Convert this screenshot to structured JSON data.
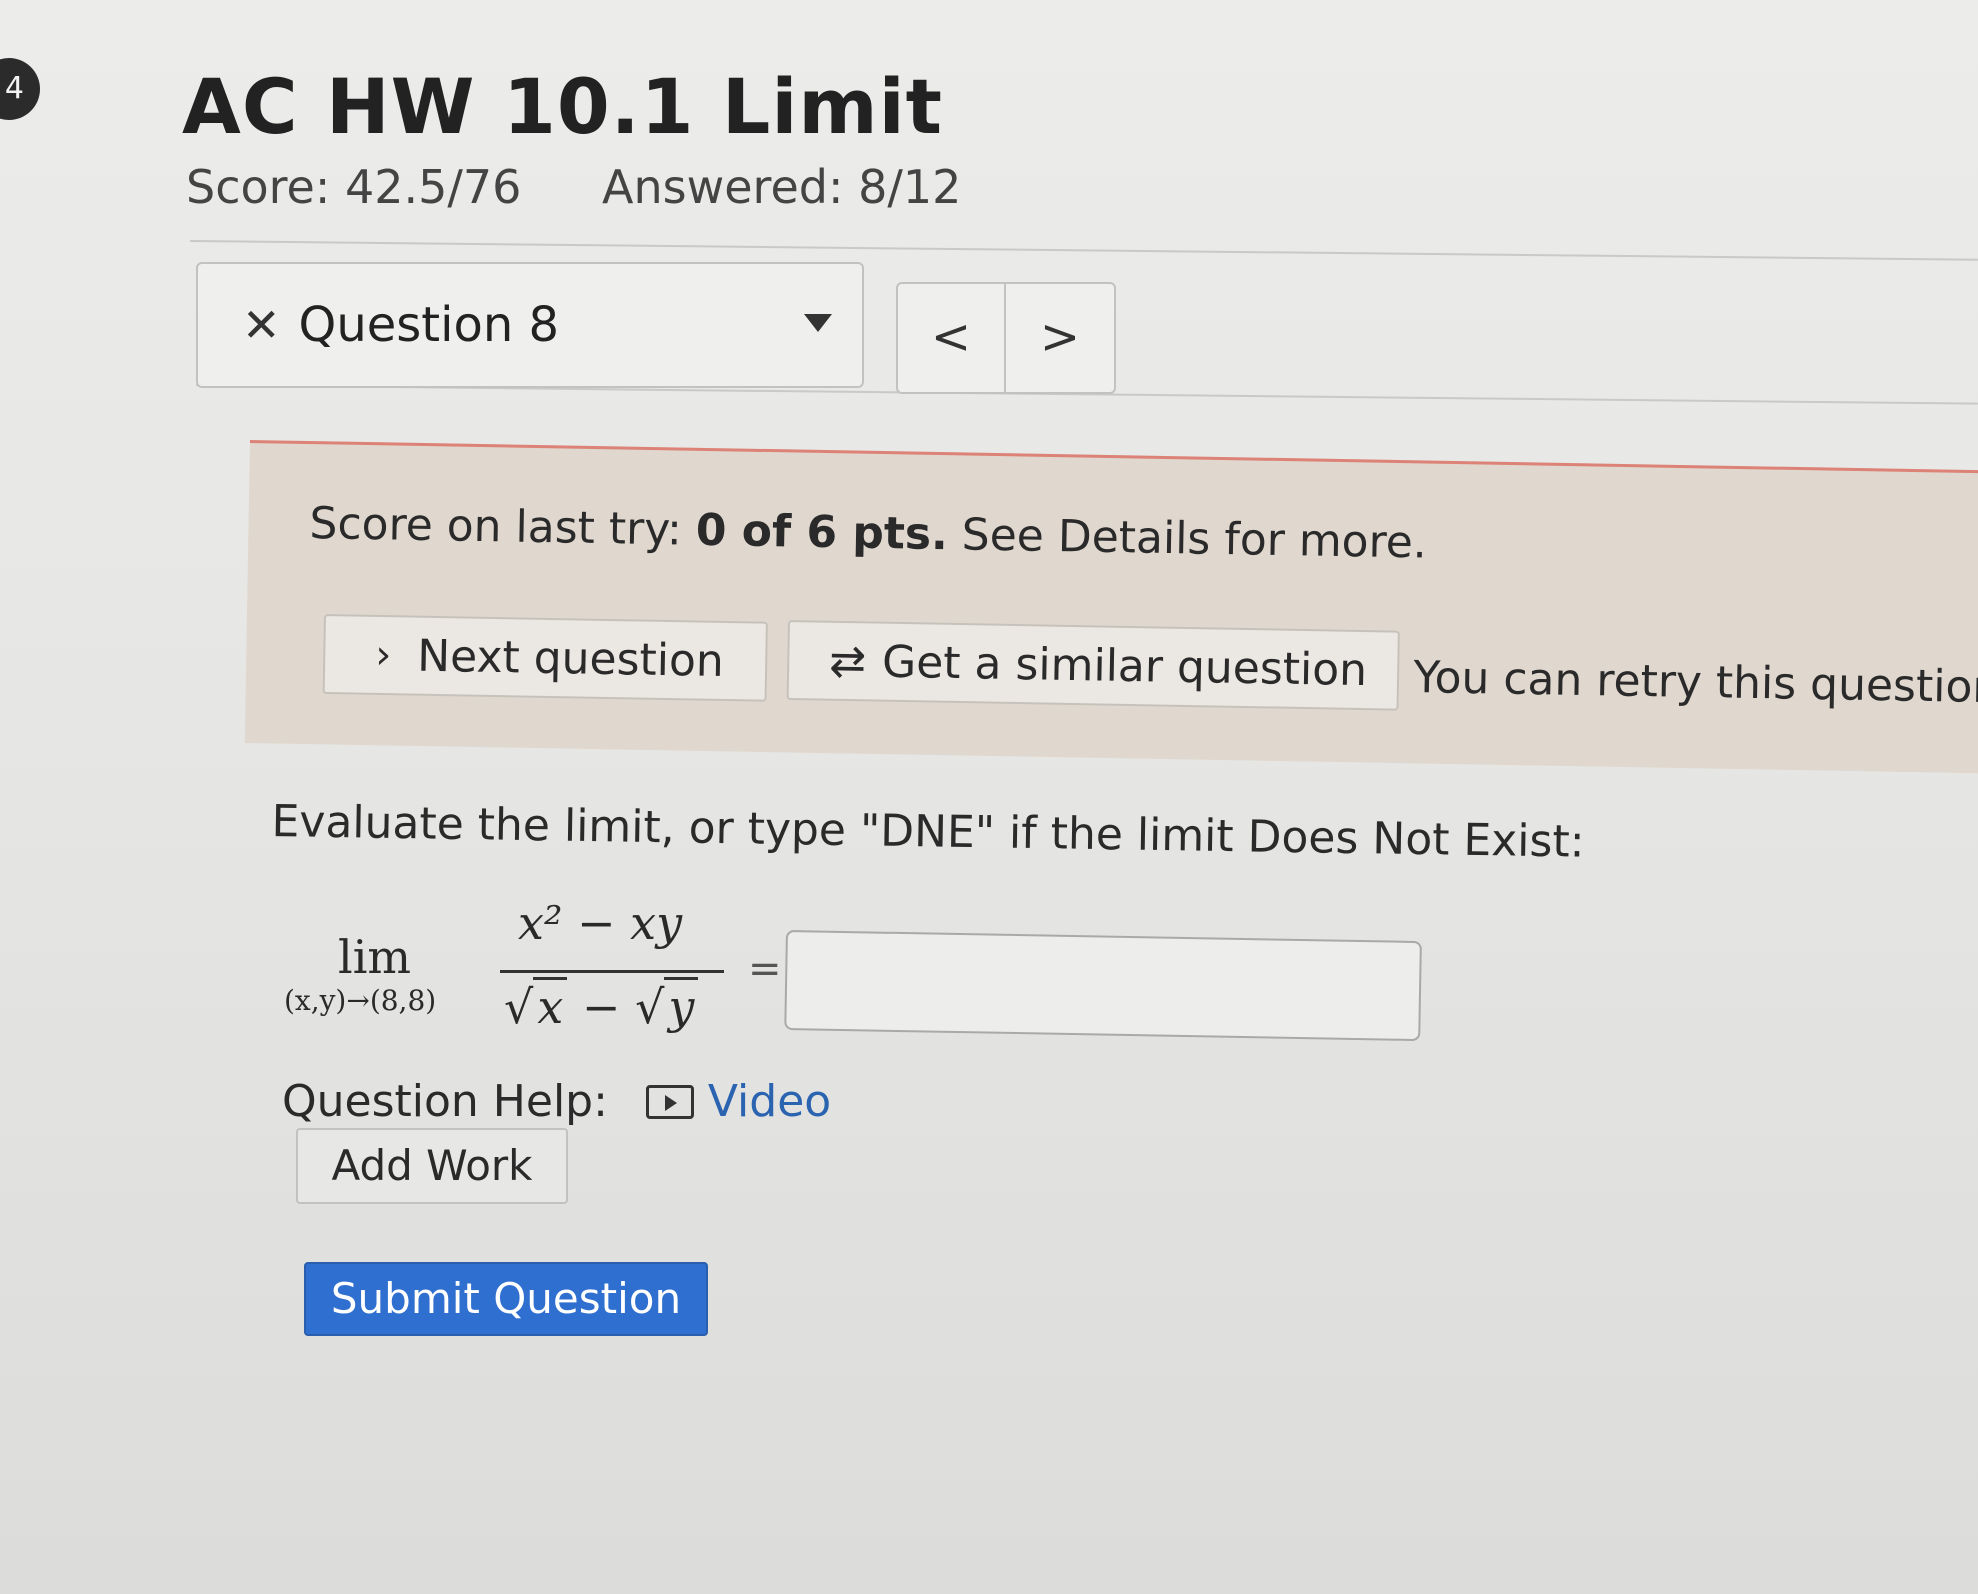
{
  "badge": {
    "number": "4"
  },
  "header": {
    "title": "AC HW 10.1 Limit",
    "score": "Score: 42.5/76",
    "answered": "Answered: 8/12"
  },
  "question_nav": {
    "status_icon": "x-icon",
    "selected_question": "Question 8",
    "prev_label": "<",
    "next_label": ">"
  },
  "feedback": {
    "text_prefix": "Score on last try: ",
    "score_bold": "0 of 6 pts.",
    "text_suffix": " See Details for more.",
    "next_question_label": "Next question",
    "similar_question_label": "Get a similar question",
    "retry_text": "You can retry this questior",
    "accent_color": "#dd8277"
  },
  "question": {
    "prompt": "Evaluate the limit, or type \"DNE\" if the limit Does Not Exist:",
    "lim_text": "lim",
    "lim_sub": "(x,y)→(8,8)",
    "numerator": "x² − xy",
    "den_x": "x",
    "den_minus": " − ",
    "den_y": "y",
    "equals": "=",
    "answer_value": "",
    "answer_placeholder": ""
  },
  "help": {
    "label": "Question Help:",
    "video_label": "Video",
    "add_work_label": "Add Work"
  },
  "actions": {
    "submit_label": "Submit Question",
    "submit_color": "#2f6fd0"
  }
}
